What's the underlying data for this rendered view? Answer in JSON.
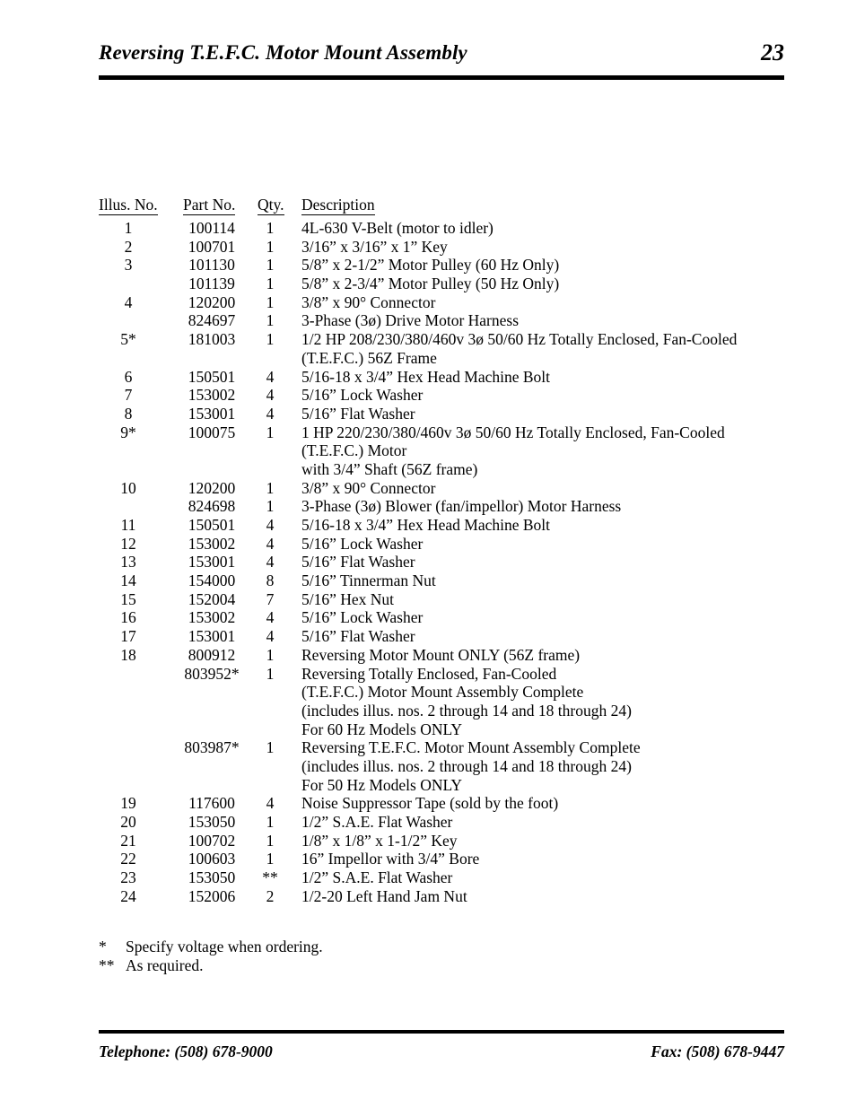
{
  "header": {
    "title": "Reversing T.E.F.C. Motor Mount Assembly",
    "page_number": "23"
  },
  "table": {
    "columns": {
      "illus": "Illus. No.",
      "part": "Part  No.",
      "qty": "Qty.",
      "description": "Description"
    },
    "rows": [
      {
        "illus": "1",
        "part": "100114",
        "qty": "1",
        "description": "4L-630 V-Belt (motor to idler)"
      },
      {
        "illus": "2",
        "part": "100701",
        "qty": "1",
        "description": "3/16” x 3/16” x 1” Key"
      },
      {
        "illus": "3",
        "part": "101130",
        "qty": "1",
        "description": "5/8” x 2-1/2” Motor Pulley (60 Hz Only)"
      },
      {
        "illus": "",
        "part": "101139",
        "qty": "1",
        "description": "5/8” x 2-3/4” Motor Pulley (50 Hz Only)"
      },
      {
        "illus": "4",
        "part": "120200",
        "qty": "1",
        "description": "3/8” x 90° Connector"
      },
      {
        "illus": "",
        "part": "824697",
        "qty": "1",
        "description": "3-Phase (3ø) Drive Motor Harness"
      },
      {
        "illus": "5*",
        "part": "181003",
        "qty": "1",
        "description": "1/2 HP 208/230/380/460v  3ø  50/60 Hz Totally Enclosed, Fan-Cooled",
        "continuation": [
          "(T.E.F.C.)  56Z  Frame"
        ]
      },
      {
        "illus": "6",
        "part": "150501",
        "qty": "4",
        "description": "5/16-18 x 3/4” Hex Head Machine Bolt"
      },
      {
        "illus": "7",
        "part": "153002",
        "qty": "4",
        "description": "5/16” Lock Washer"
      },
      {
        "illus": "8",
        "part": "153001",
        "qty": "4",
        "description": "5/16” Flat Washer"
      },
      {
        "illus": "9*",
        "part": "100075",
        "qty": "1",
        "description": "1 HP 220/230/380/460v  3ø  50/60 Hz Totally Enclosed, Fan-Cooled",
        "continuation": [
          "(T.E.F.C.)  Motor",
          "with 3/4” Shaft (56Z frame)"
        ]
      },
      {
        "illus": "10",
        "part": "120200",
        "qty": "1",
        "description": "3/8” x 90° Connector"
      },
      {
        "illus": "",
        "part": "824698",
        "qty": "1",
        "description": "3-Phase (3ø) Blower (fan/impellor) Motor Harness"
      },
      {
        "illus": "11",
        "part": "150501",
        "qty": "4",
        "description": "5/16-18 x 3/4” Hex Head Machine Bolt"
      },
      {
        "illus": "12",
        "part": "153002",
        "qty": "4",
        "description": "5/16” Lock Washer"
      },
      {
        "illus": "13",
        "part": "153001",
        "qty": "4",
        "description": "5/16” Flat Washer"
      },
      {
        "illus": "14",
        "part": "154000",
        "qty": "8",
        "description": "5/16” Tinnerman Nut"
      },
      {
        "illus": "15",
        "part": "152004",
        "qty": "7",
        "description": "5/16” Hex Nut"
      },
      {
        "illus": "16",
        "part": "153002",
        "qty": "4",
        "description": "5/16” Lock Washer"
      },
      {
        "illus": "17",
        "part": "153001",
        "qty": "4",
        "description": "5/16” Flat Washer"
      },
      {
        "illus": "18",
        "part": "800912",
        "qty": "1",
        "description": "Reversing Motor Mount ONLY (56Z frame)"
      },
      {
        "illus": "",
        "part": "803952*",
        "qty": "1",
        "description": "Reversing Totally Enclosed, Fan-Cooled",
        "continuation": [
          "(T.E.F.C.) Motor Mount Assembly Complete",
          "(includes illus. nos. 2 through 14 and 18 through 24)",
          "For 60 Hz Models ONLY"
        ]
      },
      {
        "illus": "",
        "part": "803987*",
        "qty": "1",
        "description": "Reversing T.E.F.C. Motor Mount Assembly Complete",
        "continuation": [
          "(includes illus. nos. 2 through 14 and 18 through 24)",
          "For 50 Hz Models ONLY"
        ]
      },
      {
        "illus": "19",
        "part": "117600",
        "qty": "4",
        "description": "Noise Suppressor Tape (sold by the foot)"
      },
      {
        "illus": "20",
        "part": "153050",
        "qty": "1",
        "description": "1/2” S.A.E. Flat Washer"
      },
      {
        "illus": "21",
        "part": "100702",
        "qty": "1",
        "description": "1/8” x 1/8” x 1-1/2” Key"
      },
      {
        "illus": "22",
        "part": "100603",
        "qty": "1",
        "description": "16” Impellor with 3/4” Bore"
      },
      {
        "illus": "23",
        "part": "153050",
        "qty": "**",
        "description": "1/2” S.A.E. Flat Washer"
      },
      {
        "illus": "24",
        "part": "152006",
        "qty": "2",
        "description": "1/2-20 Left Hand Jam Nut"
      }
    ]
  },
  "footnotes": [
    {
      "mark": "*",
      "text": "Specify voltage when ordering."
    },
    {
      "mark": "**",
      "text": "As required."
    }
  ],
  "footer": {
    "phone": "Telephone: (508) 678-9000",
    "fax": "Fax: (508) 678-9447"
  }
}
